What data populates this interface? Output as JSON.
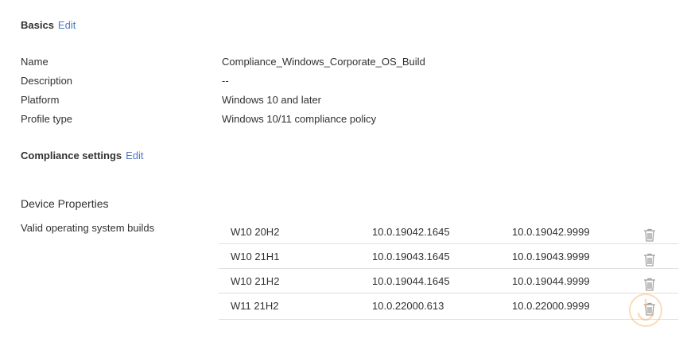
{
  "basics": {
    "title": "Basics",
    "edit_label": "Edit",
    "fields": [
      {
        "label": "Name",
        "value": "Compliance_Windows_Corporate_OS_Build"
      },
      {
        "label": "Description",
        "value": "--"
      },
      {
        "label": "Platform",
        "value": "Windows 10 and later"
      },
      {
        "label": "Profile type",
        "value": "Windows 10/11 compliance policy"
      }
    ]
  },
  "compliance": {
    "title": "Compliance settings",
    "edit_label": "Edit",
    "device_properties_heading": "Device Properties",
    "valid_builds_label": "Valid operating system builds",
    "builds": [
      {
        "name": "W10 20H2",
        "min": "10.0.19042.1645",
        "max": "10.0.19042.9999"
      },
      {
        "name": "W10 21H1",
        "min": "10.0.19043.1645",
        "max": "10.0.19043.9999"
      },
      {
        "name": "W10 21H2",
        "min": "10.0.19044.1645",
        "max": "10.0.19044.9999"
      },
      {
        "name": "W11 21H2",
        "min": "10.0.22000.613",
        "max": "10.0.22000.9999"
      }
    ],
    "delete_icon": "trash-icon"
  },
  "colors": {
    "text": "#323130",
    "link": "#4a7bc0",
    "divider": "#e1dfdd",
    "icon": "#a19f9d",
    "watermark": "#f7b26a"
  }
}
